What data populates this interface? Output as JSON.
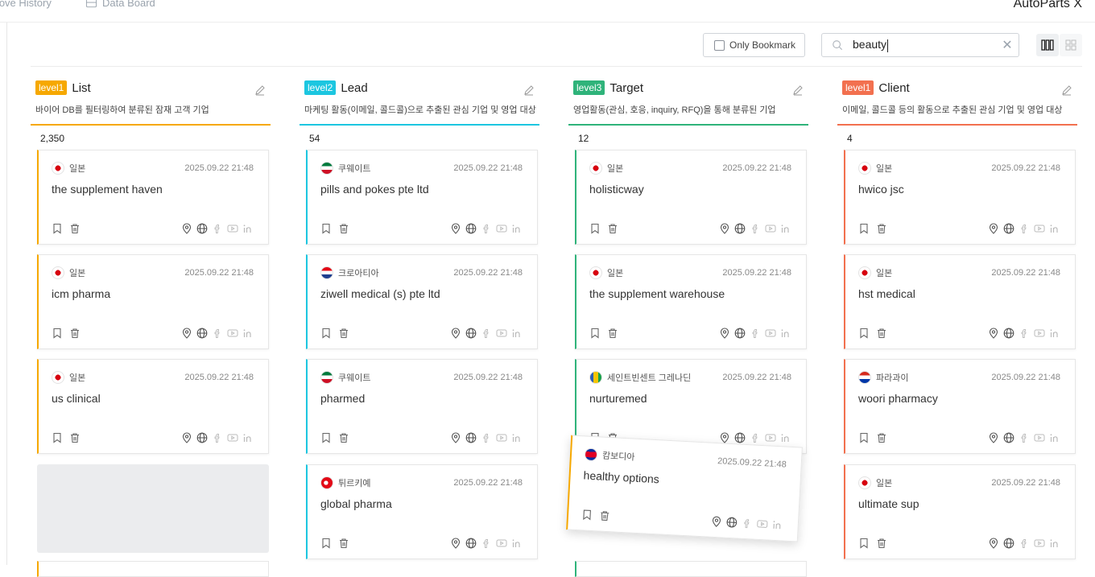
{
  "nav": {
    "move_history": "Move History",
    "data_board": "Data Board"
  },
  "brand": "AutoParts X",
  "toolbar": {
    "only_bookmark_label": "Only Bookmark",
    "search_value": "beauty",
    "clear_icon": "close-icon"
  },
  "columns": [
    {
      "level": "level1",
      "level_color": "#f6a800",
      "title": "List",
      "accent": "#f6a800",
      "description": "바이어 DB를 필터링하여 분류된 잠재 고객 기업",
      "count": "2,350",
      "cards": [
        {
          "country": "일본",
          "date": "2025.09.22 21:48",
          "name": "the supplement haven"
        },
        {
          "country": "일본",
          "date": "2025.09.22 21:48",
          "name": "icm pharma"
        },
        {
          "country": "일본",
          "date": "2025.09.22 21:48",
          "name": "us clinical"
        }
      ]
    },
    {
      "level": "level2",
      "level_color": "#1cc6e0",
      "title": "Lead",
      "accent": "#1cc6e0",
      "description": "마케팅 활동(이메일, 콜드콜)으로 추출된 관심 기업 및 영업 대상",
      "count": "54",
      "cards": [
        {
          "country": "쿠웨이트",
          "date": "2025.09.22 21:48",
          "name": "pills and pokes pte ltd"
        },
        {
          "country": "크로아티아",
          "date": "2025.09.22 21:48",
          "name": "ziwell medical (s) pte ltd"
        },
        {
          "country": "쿠웨이트",
          "date": "2025.09.22 21:48",
          "name": "pharmed"
        },
        {
          "country": "튀르키예",
          "date": "2025.09.22 21:48",
          "name": "global pharma"
        }
      ]
    },
    {
      "level": "level3",
      "level_color": "#2fb37a",
      "title": "Target",
      "accent": "#2fb37a",
      "description": "영업활동(관심, 호응, inquiry, RFQ)을 통해 분류된 기업",
      "count": "12",
      "cards": [
        {
          "country": "일본",
          "date": "2025.09.22 21:48",
          "name": "holisticway"
        },
        {
          "country": "일본",
          "date": "2025.09.22 21:48",
          "name": "the supplement warehouse"
        },
        {
          "country": "세인트빈센트 그레나딘",
          "date": "2025.09.22 21:48",
          "name": "nurturemed"
        }
      ]
    },
    {
      "level": "level1",
      "level_color": "#f2704f",
      "title": "Client",
      "accent": "#f2704f",
      "description": "이메일, 콜드콜 등의 활동으로 추출된 관심 기업 및 영업 대상",
      "count": "4",
      "cards": [
        {
          "country": "일본",
          "date": "2025.09.22 21:48",
          "name": "hwico jsc"
        },
        {
          "country": "일본",
          "date": "2025.09.22 21:48",
          "name": "hst medical"
        },
        {
          "country": "파라과이",
          "date": "2025.09.22 21:48",
          "name": "woori pharmacy"
        },
        {
          "country": "일본",
          "date": "2025.09.22 21:48",
          "name": "ultimate sup"
        }
      ]
    }
  ],
  "dragging_card": {
    "country": "캄보디아",
    "date": "2025.09.22 21:48",
    "name": "healthy options"
  }
}
